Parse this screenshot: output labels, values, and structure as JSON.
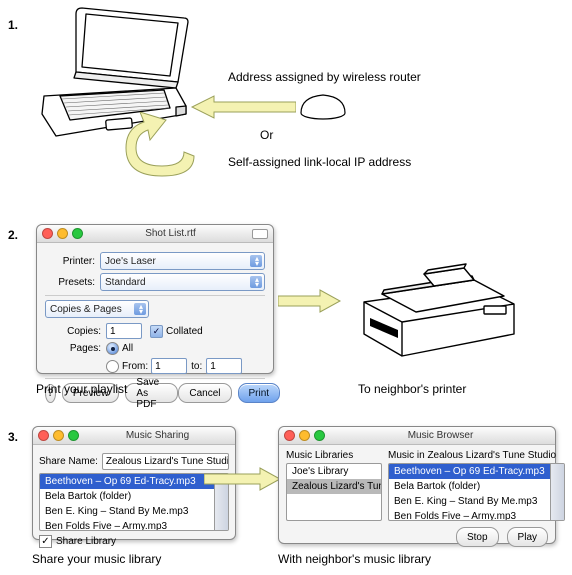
{
  "steps": {
    "s1": "1.",
    "s2": "2.",
    "s3": "3."
  },
  "section1": {
    "wireless": "Address assigned by wireless router",
    "or": "Or",
    "linklocal": "Self-assigned link-local IP address"
  },
  "print": {
    "title": "Shot List.rtf",
    "printer_lbl": "Printer:",
    "printer_val": "Joe's Laser",
    "presets_lbl": "Presets:",
    "presets_val": "Standard",
    "section": "Copies & Pages",
    "copies_lbl": "Copies:",
    "copies_val": "1",
    "collated": "Collated",
    "pages_lbl": "Pages:",
    "pages_all": "All",
    "pages_from": "From:",
    "pages_from_val": "1",
    "pages_to": "to:",
    "pages_to_val": "1",
    "help": "?",
    "preview": "Preview",
    "saveas": "Save As PDF",
    "cancel": "Cancel",
    "print_btn": "Print",
    "caption_left": "Print your playlist",
    "caption_right": "To neighbor's printer"
  },
  "share": {
    "title": "Music Sharing",
    "name_lbl": "Share Name:",
    "name_val": "Zealous Lizard's Tune Studio",
    "items": [
      "Beethoven – Op 69 Ed-Tracy.mp3",
      "Bela Bartok (folder)",
      "Ben E. King – Stand By Me.mp3",
      "Ben Folds Five – Army.mp3"
    ],
    "share_chk": "Share Library",
    "caption": "Share your music library"
  },
  "browser": {
    "title": "Music Browser",
    "libs_header": "Music Libraries",
    "libs": [
      "Joe's Library",
      "Zealous Lizard's Tune"
    ],
    "music_header": "Music in Zealous Lizard's Tune Studio",
    "items": [
      "Beethoven – Op 69 Ed-Tracy.mp3",
      "Bela Bartok (folder)",
      "Ben E. King – Stand By Me.mp3",
      "Ben Folds Five – Army.mp3"
    ],
    "stop": "Stop",
    "play": "Play",
    "caption": "With neighbor's music library"
  }
}
